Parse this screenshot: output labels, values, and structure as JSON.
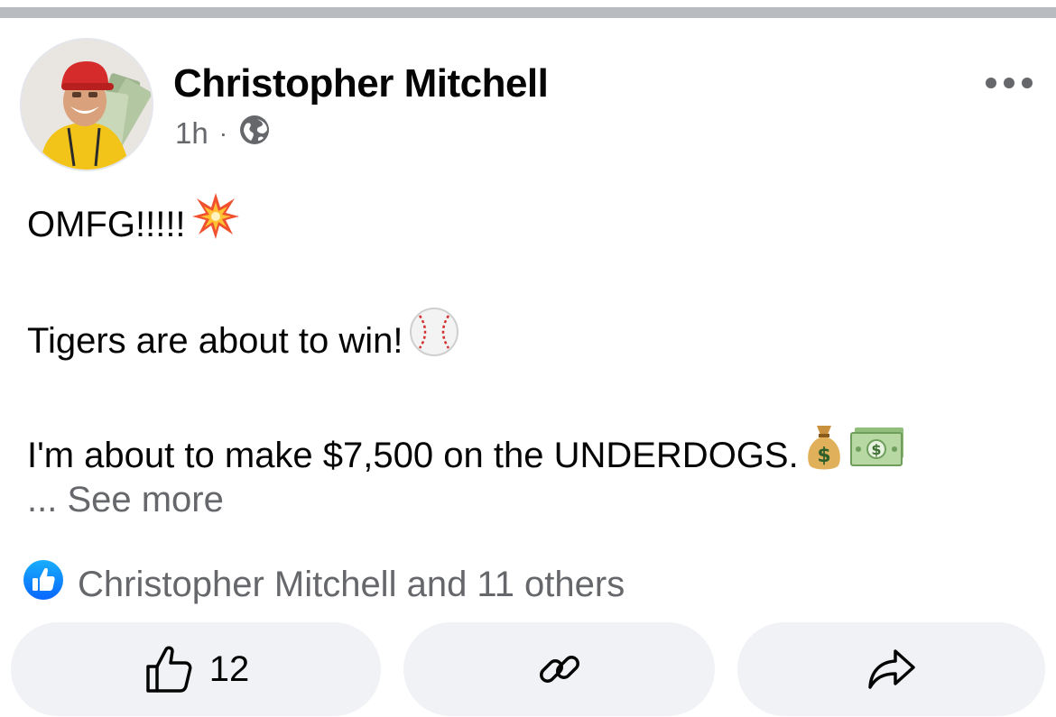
{
  "post": {
    "author_name": "Christopher Mitchell",
    "timestamp": "1h",
    "separator": "·",
    "audience_icon": "globe-icon",
    "more_icon": "more-dots-icon",
    "lines": [
      "OMFG!!!!!",
      "Tigers are about to win!",
      "I'm about to make $7,500 on the UNDERDOGS."
    ],
    "emojis": [
      "collision",
      "baseball",
      "money-bag",
      "dollar-banknote"
    ],
    "see_more_prefix": "... ",
    "see_more": "See more"
  },
  "reactions": {
    "icon": "like-reaction-icon",
    "summary": "Christopher Mitchell and 11 others"
  },
  "actions": {
    "like_count": "12",
    "like_icon": "thumbs-up-icon",
    "link_icon": "link-icon",
    "share_icon": "share-arrow-icon"
  },
  "colors": {
    "primary_text": "#050505",
    "secondary_text": "#65676b",
    "like_blue": "#1877f2",
    "button_bg": "#f0f2f5",
    "divider": "#b8bbbf"
  }
}
